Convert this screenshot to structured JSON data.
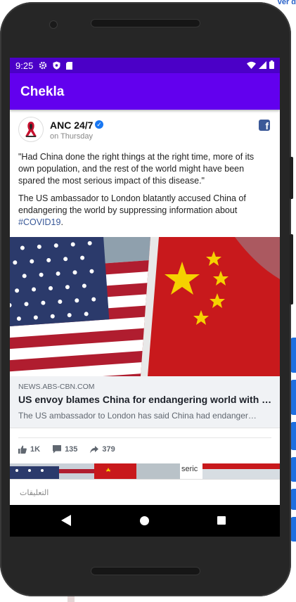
{
  "background": {
    "link_text": "ver d"
  },
  "status_bar": {
    "time": "9:25",
    "left_icons": [
      "gear-icon",
      "shield-icon",
      "sd-card-icon"
    ],
    "right_icons": [
      "wifi-icon",
      "signal-icon",
      "battery-icon"
    ]
  },
  "app_bar": {
    "title": "Chekla"
  },
  "post": {
    "author": "ANC 24/7",
    "verified": true,
    "timestamp": "on Thursday",
    "source_icon": "facebook-icon",
    "quote": "\"Had China done the right things at the right time, more of its own population, and the rest of the world might have been spared the most serious impact of this disease.\"",
    "body_prefix": "The US ambassador to London blatantly accused China of endangering the world by suppressing information about ",
    "hashtag": "#COVID19",
    "body_suffix": ".",
    "link_preview": {
      "image": "us-and-china-flags",
      "domain": "NEWS.ABS-CBN.COM",
      "title": "US envoy blames China for endangering world with …",
      "description": "The US ambassador to London has said China had endanger…"
    },
    "stats": {
      "likes": "1K",
      "comments": "135",
      "shares": "379"
    }
  },
  "comments_bar": {
    "placeholder": "التعليقات"
  },
  "colors": {
    "status_bar": "#4b00c7",
    "app_bar": "#6200ee",
    "hashtag": "#385898",
    "verified": "#1877f2"
  }
}
